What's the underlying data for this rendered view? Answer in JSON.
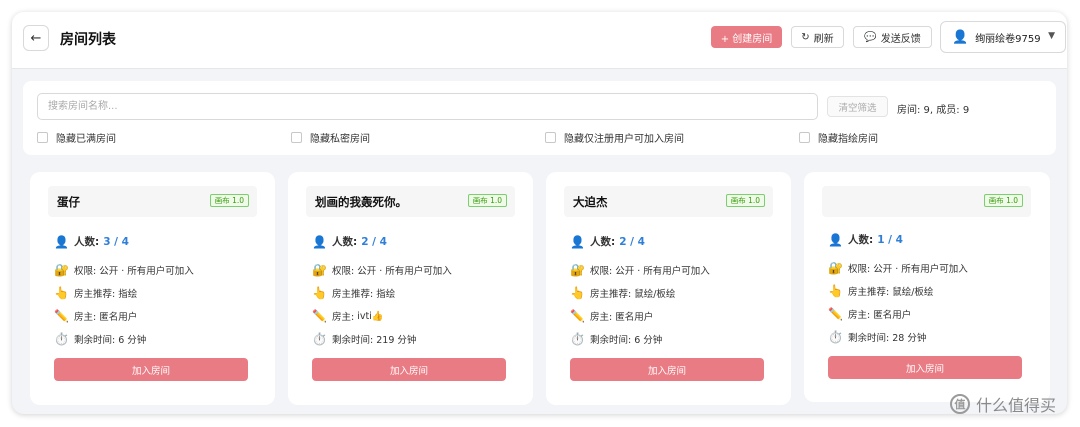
{
  "header": {
    "title": "房间列表",
    "back_icon": "←",
    "create_label": "+ 创建房间",
    "refresh_icon": "↻",
    "refresh_label": "刷新",
    "feedback_icon": "💬",
    "feedback_label": "发送反馈",
    "user_icon": "👤",
    "user_name": "绚丽绘卷9759",
    "chevron": "▼"
  },
  "filters": {
    "search_placeholder": "搜索房间名称...",
    "clear_label": "清空筛选",
    "stats": "房间: 9, 成员: 9",
    "checkboxes": [
      "隐藏已满房间",
      "隐藏私密房间",
      "隐藏仅注册用户可加入房间",
      "隐藏指绘房间"
    ]
  },
  "labels": {
    "people": "人数:",
    "permission": "权限:",
    "recommend": "房主推荐:",
    "owner": "房主:",
    "time": "剩余时间:",
    "join": "加入房间"
  },
  "icons": {
    "people": "👤",
    "permission": "🔐",
    "recommend": "👆",
    "owner": "✏️",
    "time": "⏱️"
  },
  "rooms": [
    {
      "title": "蛋仔",
      "badge": "画布 1.0",
      "people": "3 / 4",
      "permission": "公开 · 所有用户可加入",
      "recommend": "指绘",
      "owner": "匿名用户",
      "time": "6 分钟"
    },
    {
      "title": "划画的我轰死你。",
      "badge": "画布 1.0",
      "people": "2 / 4",
      "permission": "公开 · 所有用户可加入",
      "recommend": "指绘",
      "owner": "ivti👍",
      "time": "219 分钟"
    },
    {
      "title": "大迫杰",
      "badge": "画布 1.0",
      "people": "2 / 4",
      "permission": "公开 · 所有用户可加入",
      "recommend": "鼠绘/板绘",
      "owner": "匿名用户",
      "time": "6 分钟"
    },
    {
      "title": "",
      "badge": "画布 1.0",
      "people": "1 / 4",
      "permission": "公开 · 所有用户可加入",
      "recommend": "鼠绘/板绘",
      "owner": "匿名用户",
      "time": "28 分钟"
    }
  ],
  "watermark": {
    "badge": "值",
    "text": "什么值得买"
  }
}
